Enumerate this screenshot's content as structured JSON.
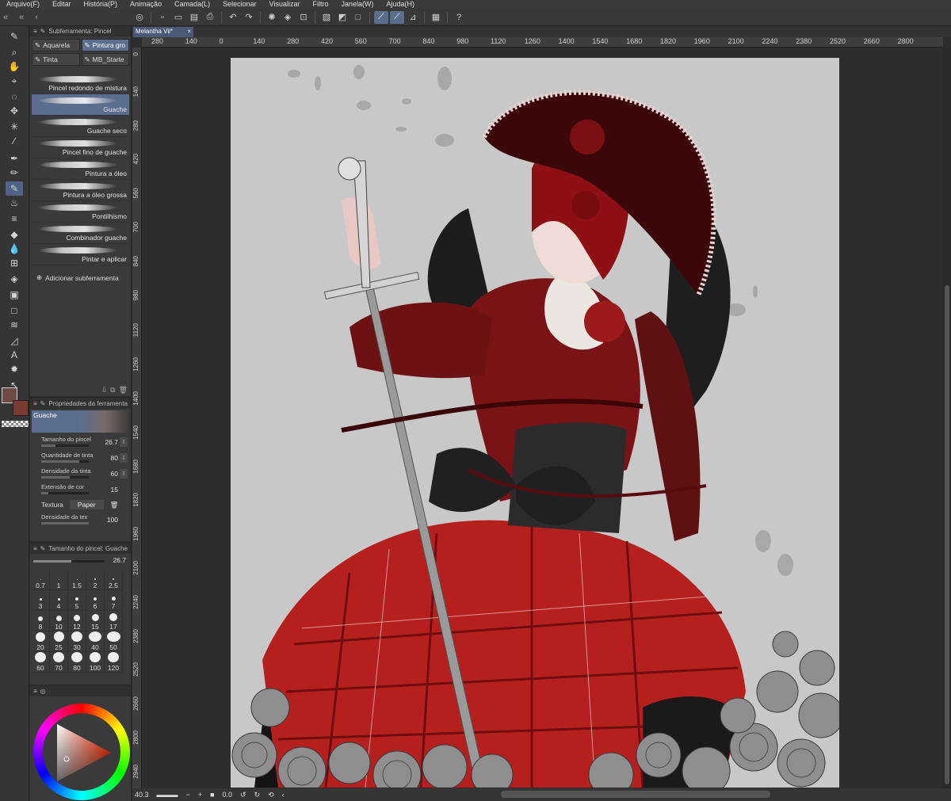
{
  "menu": [
    "Arquivo(F)",
    "Editar",
    "História(P)",
    "Animação",
    "Camada(L)",
    "Selecionar",
    "Visualizar",
    "Filtro",
    "Janela(W)",
    "Ajuda(H)"
  ],
  "subtool_panel": {
    "title": "Subferramenta: Pincel",
    "groups": [
      "Aquarela",
      "Pintura gro",
      "Tinta",
      "MB_Starte"
    ],
    "brushes": [
      "Pincel redondo de mistura",
      "Guache",
      "Guache seco",
      "Pincel fino de guache",
      "Pintura a óleo",
      "Pintura a óleo grossa",
      "Pontilhismo",
      "Combinador guache",
      "Pintar e aplicar"
    ],
    "add_label": "Adicionar subferramenta"
  },
  "tool_property": {
    "title": "Propriedades da ferramenta",
    "brush_name": "Guache",
    "rows": [
      {
        "label": "Tamanho do pincel",
        "value": "26.7"
      },
      {
        "label": "Quantidade de tinta",
        "value": "80"
      },
      {
        "label": "Densidade da tinta",
        "value": "60"
      },
      {
        "label": "Extensão de cor",
        "value": "15"
      }
    ],
    "texture_label": "Textura",
    "texture_value": "Paper",
    "density_label": "Densidade da tex",
    "density_value": "100"
  },
  "brush_size": {
    "title": "Tamanho do pincel: Guache",
    "value": "26.7",
    "sizes": [
      "0.7",
      "1",
      "1.5",
      "2",
      "2.5",
      "3",
      "4",
      "5",
      "6",
      "7",
      "8",
      "10",
      "12",
      "15",
      "17",
      "20",
      "25",
      "30",
      "40",
      "50",
      "60",
      "70",
      "80",
      "100",
      "120"
    ]
  },
  "document": {
    "tab": "Melantha Vii*",
    "zoom": "40.3",
    "rotation": "0.0"
  },
  "ruler_h": [
    "280",
    "140",
    "0",
    "140",
    "280",
    "420",
    "560",
    "700",
    "840",
    "980",
    "1120",
    "1260",
    "1400",
    "1540",
    "1680",
    "1820",
    "1960",
    "2100",
    "2240",
    "2380",
    "2520",
    "2660",
    "2800"
  ],
  "ruler_v": [
    "0",
    "140",
    "280",
    "420",
    "560",
    "700",
    "840",
    "980",
    "1120",
    "1260",
    "1400",
    "1540",
    "1680",
    "1820",
    "1960",
    "2100",
    "2240",
    "2380",
    "2520",
    "2660",
    "2800",
    "2940"
  ],
  "colors": {
    "main": "#6e4a44",
    "sub": "#7b3a30",
    "accent": "#5c6e8f"
  }
}
